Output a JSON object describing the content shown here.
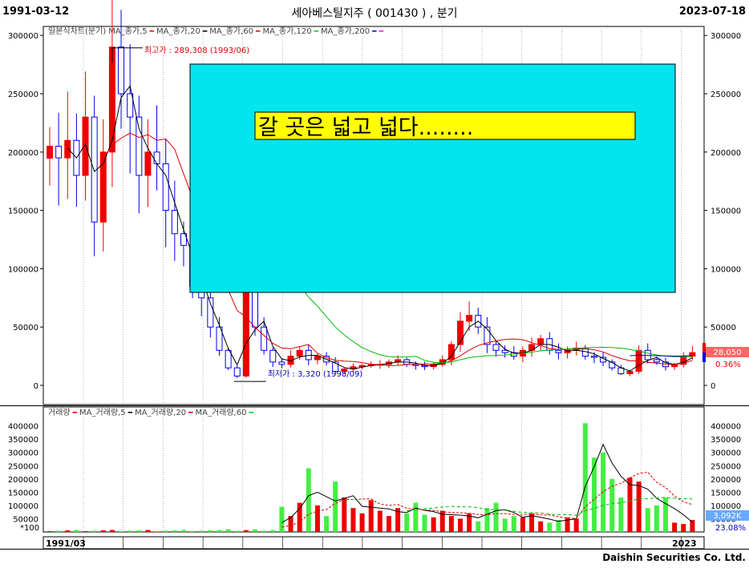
{
  "header": {
    "start_date": "1991-03-12",
    "title": "세아베스틸지주 ( 001430 ) , 분기",
    "end_date": "2023-07-18"
  },
  "footer": {
    "brand": "Daishin Securities Co. Ltd."
  },
  "price_panel": {
    "legend": [
      {
        "text": "일본식차트(분기)",
        "marker": "",
        "color": "#444444"
      },
      {
        "text": "MA_종가,5",
        "marker": "━",
        "color": "#dd0000"
      },
      {
        "text": "MA_종가,20",
        "marker": "━",
        "color": "#000000"
      },
      {
        "text": "MA_종가,60",
        "marker": "━",
        "color": "#dd0000"
      },
      {
        "text": "MA_종가,120",
        "marker": "━",
        "color": "#00cc00"
      },
      {
        "text": "MA_종가,200",
        "marker": "━",
        "color": "#0000cc"
      },
      {
        "text": "",
        "marker": "━",
        "color": "#ff00ff"
      }
    ],
    "y_ticks": [
      300000,
      250000,
      200000,
      150000,
      100000,
      50000,
      0
    ],
    "y_tick_labels": [
      "300000",
      "250000",
      "200000",
      "150000",
      "100000",
      "50000",
      "0"
    ],
    "high_label": "최고가 : 289,308 (1993/06)",
    "low_label": "최저가 : 3,320 (1998/09)",
    "current_price": "28,050",
    "current_change": "0.36%",
    "annotation": "갈  곳은  넓고  넓다........"
  },
  "volume_panel": {
    "legend": [
      {
        "text": "거래량",
        "marker": "━",
        "color": "#dd0000"
      },
      {
        "text": "MA_거래량,5",
        "marker": "━",
        "color": "#000000"
      },
      {
        "text": "MA_거래량,20",
        "marker": "━",
        "color": "#dd0000"
      },
      {
        "text": "MA_거래량,60",
        "marker": "━",
        "color": "#00cc00"
      }
    ],
    "y_tick_labels": [
      "400000",
      "350000",
      "300000",
      "250000",
      "200000",
      "150000",
      "100000",
      "50000"
    ],
    "unit_label": "*100",
    "current_volume": "3,092K",
    "current_pct": "23.08%"
  },
  "x_axis": {
    "start_label": "1991/03",
    "end_label": "2023"
  },
  "colors": {
    "up": "#ee0000",
    "down": "#0000ee",
    "highlight_box": "#00e5ee",
    "annotation_bg": "#ffff00",
    "volume_up": "#ee0000",
    "volume_down": "#44ee44"
  },
  "chart_data": [
    {
      "type": "candlestick",
      "title": "세아베스틸지주 ( 001430 ) , 분기",
      "ylim": [
        0,
        300000
      ],
      "high": {
        "value": 289308,
        "date": "1993/06"
      },
      "low": {
        "value": 3320,
        "date": "1998/09"
      },
      "last_close": 28050,
      "approx_quarterly_close": [
        205000,
        195000,
        210000,
        180000,
        230000,
        140000,
        200000,
        290000,
        250000,
        230000,
        180000,
        200000,
        190000,
        150000,
        130000,
        120000,
        85000,
        75000,
        50000,
        30000,
        15000,
        8000,
        85000,
        50000,
        30000,
        20000,
        18000,
        25000,
        30000,
        22000,
        25000,
        20000,
        12000,
        14000,
        16000,
        17000,
        18000,
        18000,
        20000,
        22000,
        18000,
        17000,
        16000,
        18000,
        22000,
        35000,
        55000,
        60000,
        50000,
        35000,
        30000,
        28000,
        25000,
        30000,
        35000,
        40000,
        30000,
        28000,
        30000,
        32000,
        25000,
        24000,
        20000,
        15000,
        10000,
        12000,
        30000,
        22000,
        20000,
        16000,
        18000,
        25000,
        28050
      ],
      "moving_average_labels": [
        "MA_종가,5",
        "MA_종가,20",
        "MA_종가,60",
        "MA_종가,120",
        "MA_종가,200"
      ]
    },
    {
      "type": "bar",
      "title": "거래량",
      "ylim": [
        0,
        420000
      ],
      "unit": "*100",
      "approx_peaks": [
        {
          "value": 95000
        },
        {
          "value": 240000
        },
        {
          "value": 190000
        },
        {
          "value": 410000
        },
        {
          "value": 300000
        },
        {
          "value": 280000
        },
        {
          "value": 205000
        }
      ],
      "last_volume": "3,092K"
    }
  ]
}
